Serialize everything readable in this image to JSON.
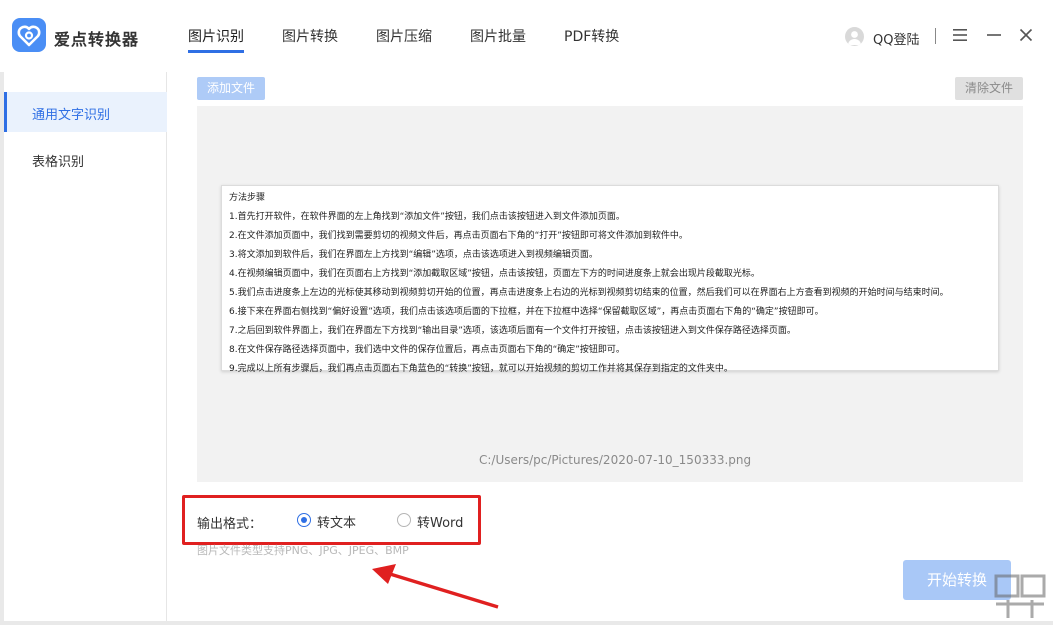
{
  "app": {
    "title": "爱点转换器"
  },
  "nav": {
    "tabs": [
      {
        "label": "图片识别",
        "active": true
      },
      {
        "label": "图片转换",
        "active": false
      },
      {
        "label": "图片压缩",
        "active": false
      },
      {
        "label": "图片批量",
        "active": false
      },
      {
        "label": "PDF转换",
        "active": false
      }
    ]
  },
  "user": {
    "login_label": "QQ登陆"
  },
  "window_controls": [
    "menu-icon",
    "minimize-icon",
    "close-icon"
  ],
  "sidebar": {
    "items": [
      {
        "label": "通用文字识别",
        "active": true
      },
      {
        "label": "表格识别",
        "active": false
      }
    ]
  },
  "toolbar": {
    "add_file_label": "添加文件",
    "clear_file_label": "清除文件"
  },
  "preview": {
    "doc_lines": [
      "方法步骤",
      "1.首先打开软件，在软件界面的左上角找到“添加文件”按钮，我们点击该按钮进入到文件添加页面。",
      "2.在文件添加页面中，我们找到需要剪切的视频文件后，再点击页面右下角的“打开”按钮即可将文件添加到软件中。",
      "3.将文添加到软件后，我们在界面左上方找到“编辑”选项，点击该选项进入到视频编辑页面。",
      "4.在视频编辑页面中，我们在页面右上方找到“添加截取区域”按钮，点击该按钮，页面左下方的时间进度条上就会出现片段截取光标。",
      "5.我们点击进度条上左边的光标使其移动到视频剪切开始的位置，再点击进度条上右边的光标到视频剪切结束的位置，然后我们可以在界面右上方查看到视频的开始时间与结束时间。",
      "6.接下来在界面右侧找到“偏好设置”选项，我们点击该选项后面的下拉框，并在下拉框中选择“保留截取区域”，再点击页面右下角的“确定”按钮即可。",
      "7.之后回到软件界面上，我们在界面左下方找到“输出目录”选项，该选项后面有一个文件打开按钮，点击该按钮进入到文件保存路径选择页面。",
      "8.在文件保存路径选择页面中，我们选中文件的保存位置后，再点击页面右下角的“确定”按钮即可。",
      "9.完成以上所有步骤后，我们再点击页面右下角蓝色的“转换”按钮，就可以开始视频的剪切工作并将其保存到指定的文件夹中。"
    ],
    "file_path": "C:/Users/pc/Pictures/2020-07-10_150333.png"
  },
  "output": {
    "label": "输出格式：",
    "options": [
      {
        "label": "转文本",
        "checked": true
      },
      {
        "label": "转Word",
        "checked": false
      }
    ]
  },
  "hint": "图片文件类型支持PNG、JPG、JPEG、BMP",
  "start_button_label": "开始转换",
  "colors": {
    "accent": "#2f6fe4",
    "highlight": "#e02020",
    "button_disabled": "#a9c8f7"
  }
}
